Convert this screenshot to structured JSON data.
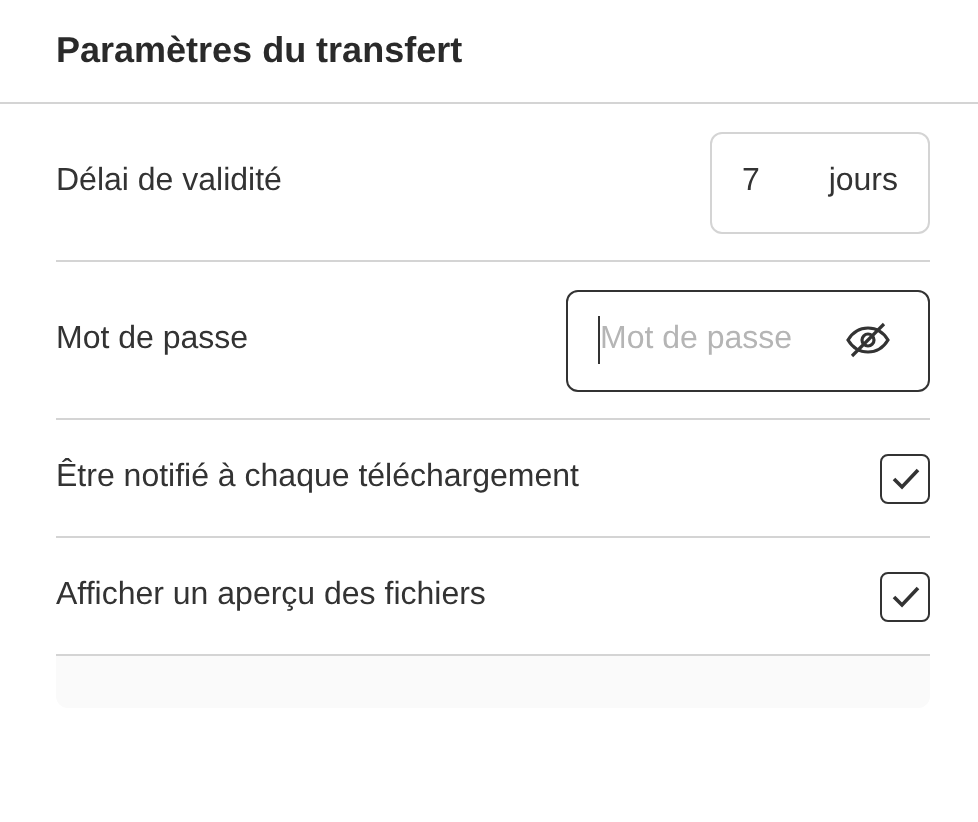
{
  "title": "Paramètres du transfert",
  "settings": [
    {
      "kind": "number",
      "label": "Délai de validité",
      "value": "7",
      "unit": "jours"
    },
    {
      "kind": "password",
      "label": "Mot de passe",
      "placeholder": "Mot de passe",
      "focused": true
    },
    {
      "kind": "checkbox",
      "label": "Être notifié à chaque téléchargement",
      "checked": true
    },
    {
      "kind": "checkbox",
      "label": "Afficher un aperçu des fichiers",
      "checked": true
    }
  ]
}
